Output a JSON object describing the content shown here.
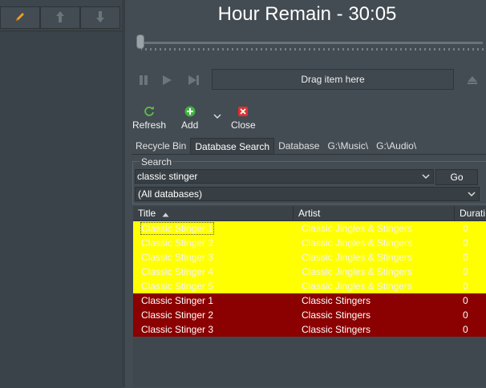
{
  "header": {
    "title": "Hour Remain - 30:05"
  },
  "transport": {
    "drop_zone_label": "Drag item here"
  },
  "actions": [
    {
      "label": "Refresh",
      "icon": "refresh-icon"
    },
    {
      "label": "Add",
      "icon": "add-icon"
    },
    {
      "label": "Close",
      "icon": "close-icon"
    }
  ],
  "tabs": [
    "Recycle Bin",
    "Database Search",
    "Database",
    "G:\\Music\\",
    "G:\\Audio\\"
  ],
  "active_tab": "Database Search",
  "search": {
    "group_label": "Search",
    "query": "classic stinger",
    "go_label": "Go",
    "database_scope": "(All databases)"
  },
  "grid": {
    "columns": [
      "Title",
      "Artist",
      "Durati"
    ],
    "rows": [
      {
        "title": "Classic Stinger 1",
        "artist": "Classic Jingles & Stingers",
        "duration": "0",
        "state": "yellow"
      },
      {
        "title": "Classic Stinger 2",
        "artist": "Classic Jingles & Stingers",
        "duration": "0",
        "state": "yellow"
      },
      {
        "title": "Classic Stinger 3",
        "artist": "Classic Jingles & Stingers",
        "duration": "0",
        "state": "yellow"
      },
      {
        "title": "Classic Stinger 4",
        "artist": "Classic Jingles & Stingers",
        "duration": "0",
        "state": "yellow"
      },
      {
        "title": "Classic Stinger 5",
        "artist": "Classic Jingles & Stingers",
        "duration": "0",
        "state": "yellow"
      },
      {
        "title": "Classic Stinger 1",
        "artist": "Classic Stingers",
        "duration": "0",
        "state": "red"
      },
      {
        "title": "Classic Stinger 2",
        "artist": "Classic Stingers",
        "duration": "0",
        "state": "red"
      },
      {
        "title": "Classic Stinger 3",
        "artist": "Classic Stingers",
        "duration": "0",
        "state": "red"
      }
    ]
  },
  "colors": {
    "background": "#434c52",
    "highlight_yellow": "#ffff00",
    "highlight_red": "#8b0000",
    "edit_icon": "#f0a020",
    "refresh_icon": "#5cc24a",
    "add_icon": "#3fb43f",
    "close_icon": "#e03030"
  }
}
